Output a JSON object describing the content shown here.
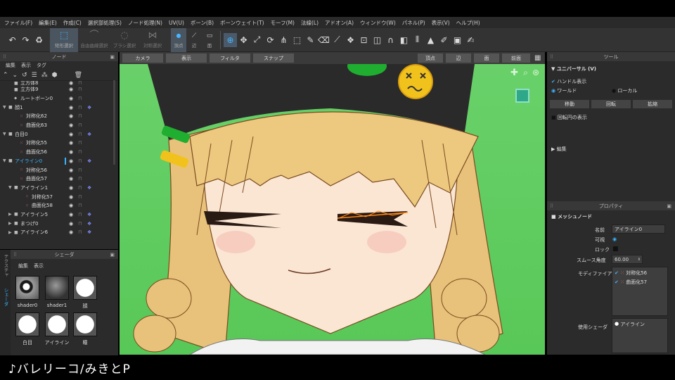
{
  "menu": [
    "ファイル(F)",
    "編集(E)",
    "作成(C)",
    "選択部処理(S)",
    "ノード処理(N)",
    "UV(U)",
    "ボーン(B)",
    "ボーンウェイト(T)",
    "モーフ(M)",
    "法線(L)",
    "アドオン(A)",
    "ウィンドウ(W)",
    "パネル(P)",
    "表示(V)",
    "ヘルプ(H)"
  ],
  "toolbar": {
    "select_rect": "矩形選択",
    "select_lasso": "自由曲線選択",
    "select_brush": "ブラシ選択",
    "select_sym": "対称選択",
    "vertex": "頂点",
    "edge": "辺",
    "face": "面"
  },
  "node_panel": {
    "title": "ノード",
    "tabs": [
      "編集",
      "表示",
      "タグ"
    ],
    "rows": [
      {
        "label": "立方体8",
        "indent": 1,
        "type": "mesh",
        "partial": true
      },
      {
        "label": "立方体9",
        "indent": 1,
        "type": "mesh"
      },
      {
        "label": "ルートボーン0",
        "indent": 1,
        "type": "bone"
      },
      {
        "label": "顔1",
        "indent": 0,
        "type": "mesh",
        "expand": true,
        "link": true
      },
      {
        "label": "対称化62",
        "indent": 2,
        "type": "mod"
      },
      {
        "label": "曲面化63",
        "indent": 2,
        "type": "mod"
      },
      {
        "label": "白目0",
        "indent": 0,
        "type": "mesh",
        "expand": true,
        "link": true
      },
      {
        "label": "対称化55",
        "indent": 2,
        "type": "mod"
      },
      {
        "label": "曲面化56",
        "indent": 2,
        "type": "mod"
      },
      {
        "label": "アイライン0",
        "indent": 0,
        "type": "mesh",
        "expand": true,
        "link": true,
        "selected": true
      },
      {
        "label": "対称化56",
        "indent": 2,
        "type": "mod"
      },
      {
        "label": "曲面化57",
        "indent": 2,
        "type": "mod"
      },
      {
        "label": "アイライン1",
        "indent": 1,
        "type": "mesh",
        "expand": true,
        "link": true
      },
      {
        "label": "対称化57",
        "indent": 3,
        "type": "mod"
      },
      {
        "label": "曲面化58",
        "indent": 3,
        "type": "mod"
      },
      {
        "label": "アイライン5",
        "indent": 1,
        "type": "mesh",
        "collapsed": true,
        "link": true
      },
      {
        "label": "まつげ0",
        "indent": 1,
        "type": "mesh",
        "collapsed": true,
        "link": true
      },
      {
        "label": "アイライン6",
        "indent": 1,
        "type": "mesh",
        "collapsed": true,
        "link": true
      }
    ]
  },
  "shader_panel": {
    "title": "シェーダ",
    "side_tabs": [
      "シェーダ",
      "テクスチャ"
    ],
    "tabs": [
      "編集",
      "表示"
    ],
    "items": [
      "shader0",
      "shader1",
      "顔",
      "白目",
      "アイライン",
      "瞳"
    ]
  },
  "viewport": {
    "tabs": [
      "カメラ",
      "表示",
      "フィルタ",
      "スナップ"
    ],
    "modes": [
      "頂点",
      "辺",
      "面"
    ],
    "view": "前面"
  },
  "tool_panel": {
    "title": "ツール",
    "section": "ユニバーサル (V)",
    "handle_show": "ハンドル表示",
    "world": "ワールド",
    "local": "ローカル",
    "move": "移動",
    "rotate": "回転",
    "scale": "拡縮",
    "rot_circle": "回転円の表示",
    "edit": "編集"
  },
  "property_panel": {
    "title": "プロパティ",
    "section": "メッシュノード",
    "name_label": "名前",
    "name_value": "アイライン0",
    "visible_label": "可視",
    "lock_label": "ロック",
    "smooth_label": "スムース角度",
    "smooth_value": "60.00",
    "modifier_label": "モディファイア",
    "modifiers": [
      "対称化56",
      "曲面化57"
    ],
    "shader_label": "使用シェーダ",
    "shader_value": "アイライン"
  },
  "caption": "♪バレリーコ/みきとP"
}
